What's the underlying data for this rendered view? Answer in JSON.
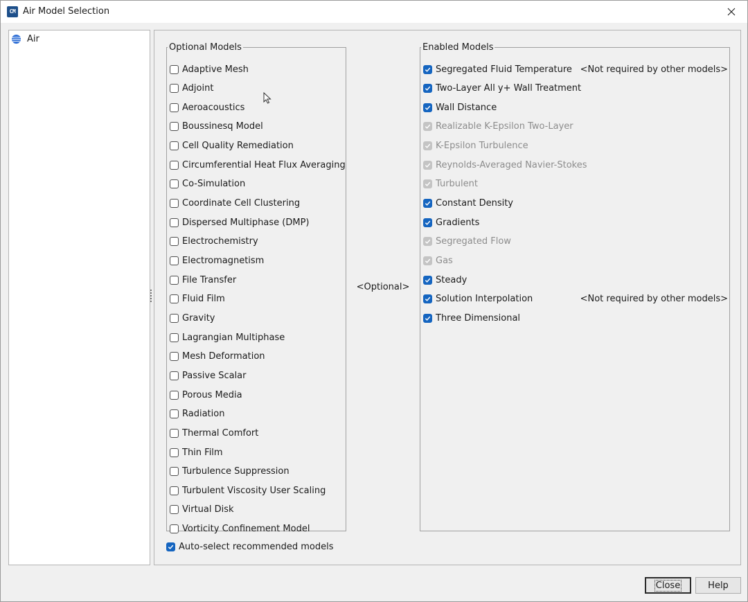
{
  "window": {
    "title": "Air Model Selection"
  },
  "tree": {
    "items": [
      {
        "label": "Air"
      }
    ]
  },
  "optional": {
    "legend": "Optional Models",
    "items": [
      {
        "label": "Adaptive Mesh",
        "checked": false
      },
      {
        "label": "Adjoint",
        "checked": false
      },
      {
        "label": "Aeroacoustics",
        "checked": false
      },
      {
        "label": "Boussinesq Model",
        "checked": false
      },
      {
        "label": "Cell Quality Remediation",
        "checked": false
      },
      {
        "label": "Circumferential Heat Flux Averaging",
        "checked": false
      },
      {
        "label": "Co-Simulation",
        "checked": false
      },
      {
        "label": "Coordinate Cell Clustering",
        "checked": false
      },
      {
        "label": "Dispersed Multiphase (DMP)",
        "checked": false
      },
      {
        "label": "Electrochemistry",
        "checked": false
      },
      {
        "label": "Electromagnetism",
        "checked": false
      },
      {
        "label": "File Transfer",
        "checked": false
      },
      {
        "label": "Fluid Film",
        "checked": false
      },
      {
        "label": "Gravity",
        "checked": false
      },
      {
        "label": "Lagrangian Multiphase",
        "checked": false
      },
      {
        "label": "Mesh Deformation",
        "checked": false
      },
      {
        "label": "Passive Scalar",
        "checked": false
      },
      {
        "label": "Porous Media",
        "checked": false
      },
      {
        "label": "Radiation",
        "checked": false
      },
      {
        "label": "Thermal Comfort",
        "checked": false
      },
      {
        "label": "Thin Film",
        "checked": false
      },
      {
        "label": "Turbulence Suppression",
        "checked": false
      },
      {
        "label": "Turbulent Viscosity User Scaling",
        "checked": false
      },
      {
        "label": "Virtual Disk",
        "checked": false
      },
      {
        "label": "Vorticity Confinement Model",
        "checked": false
      }
    ]
  },
  "center_label": "<Optional>",
  "enabled": {
    "legend": "Enabled Models",
    "items": [
      {
        "label": "Segregated Fluid Temperature",
        "checked": true,
        "disabled": false,
        "note": "<Not required by other models>"
      },
      {
        "label": "Two-Layer All y+ Wall Treatment",
        "checked": true,
        "disabled": false,
        "note": ""
      },
      {
        "label": "Wall Distance",
        "checked": true,
        "disabled": false,
        "note": ""
      },
      {
        "label": "Realizable K-Epsilon Two-Layer",
        "checked": true,
        "disabled": true,
        "note": ""
      },
      {
        "label": "K-Epsilon Turbulence",
        "checked": true,
        "disabled": true,
        "note": ""
      },
      {
        "label": "Reynolds-Averaged Navier-Stokes",
        "checked": true,
        "disabled": true,
        "note": ""
      },
      {
        "label": "Turbulent",
        "checked": true,
        "disabled": true,
        "note": ""
      },
      {
        "label": "Constant Density",
        "checked": true,
        "disabled": false,
        "note": ""
      },
      {
        "label": "Gradients",
        "checked": true,
        "disabled": false,
        "note": ""
      },
      {
        "label": "Segregated Flow",
        "checked": true,
        "disabled": true,
        "note": ""
      },
      {
        "label": "Gas",
        "checked": true,
        "disabled": true,
        "note": ""
      },
      {
        "label": "Steady",
        "checked": true,
        "disabled": false,
        "note": ""
      },
      {
        "label": "Solution Interpolation",
        "checked": true,
        "disabled": false,
        "note": "<Not required by other models>"
      },
      {
        "label": "Three Dimensional",
        "checked": true,
        "disabled": false,
        "note": ""
      }
    ]
  },
  "auto_select": {
    "label": "Auto-select recommended models",
    "checked": true
  },
  "buttons": {
    "close": "Close",
    "help": "Help"
  },
  "colors": {
    "accent": "#1565c0",
    "disabled_check": "#c4c4c4",
    "disabled_text": "#8c8c8c"
  }
}
